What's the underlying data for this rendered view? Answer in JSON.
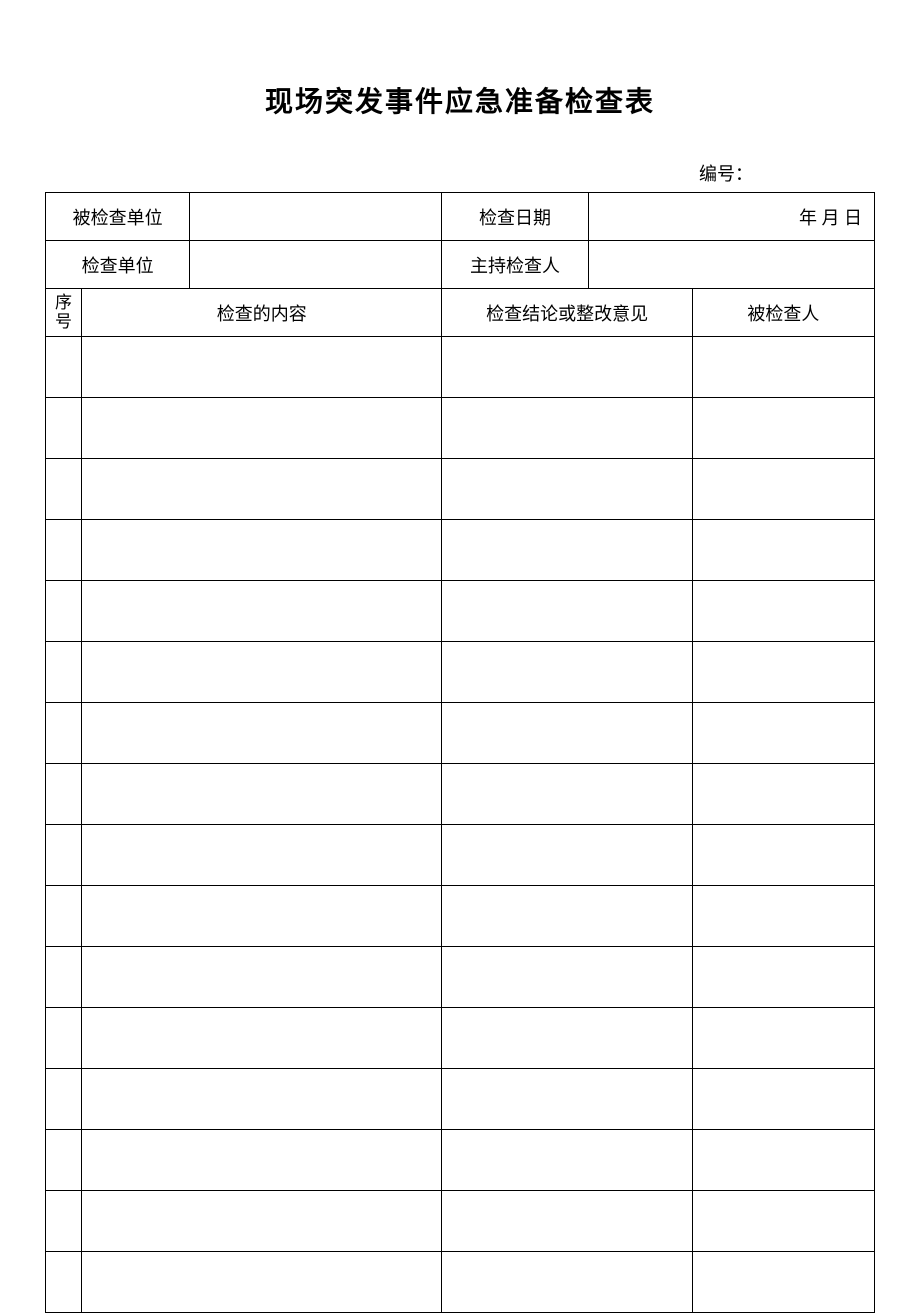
{
  "title": "现场突发事件应急准备检查表",
  "doc_number_label": "编号：",
  "header": {
    "inspected_unit_label": "被检查单位",
    "inspected_unit_value": "",
    "inspection_date_label": "检查日期",
    "date_value": "年  月 日",
    "inspecting_unit_label": "检查单位",
    "inspecting_unit_value": "",
    "presiding_inspector_label": "主持检查人",
    "presiding_inspector_value": ""
  },
  "columns": {
    "seq": "序号",
    "content": "检查的内容",
    "conclusion": "检查结论或整改意见",
    "inspected_person": "被检查人"
  },
  "rows": [
    {
      "seq": "",
      "content": "",
      "conclusion": "",
      "person": ""
    },
    {
      "seq": "",
      "content": "",
      "conclusion": "",
      "person": ""
    },
    {
      "seq": "",
      "content": "",
      "conclusion": "",
      "person": ""
    },
    {
      "seq": "",
      "content": "",
      "conclusion": "",
      "person": ""
    },
    {
      "seq": "",
      "content": "",
      "conclusion": "",
      "person": ""
    },
    {
      "seq": "",
      "content": "",
      "conclusion": "",
      "person": ""
    },
    {
      "seq": "",
      "content": "",
      "conclusion": "",
      "person": ""
    },
    {
      "seq": "",
      "content": "",
      "conclusion": "",
      "person": ""
    },
    {
      "seq": "",
      "content": "",
      "conclusion": "",
      "person": ""
    },
    {
      "seq": "",
      "content": "",
      "conclusion": "",
      "person": ""
    },
    {
      "seq": "",
      "content": "",
      "conclusion": "",
      "person": ""
    },
    {
      "seq": "",
      "content": "",
      "conclusion": "",
      "person": ""
    },
    {
      "seq": "",
      "content": "",
      "conclusion": "",
      "person": ""
    },
    {
      "seq": "",
      "content": "",
      "conclusion": "",
      "person": ""
    },
    {
      "seq": "",
      "content": "",
      "conclusion": "",
      "person": ""
    },
    {
      "seq": "",
      "content": "",
      "conclusion": "",
      "person": ""
    }
  ]
}
